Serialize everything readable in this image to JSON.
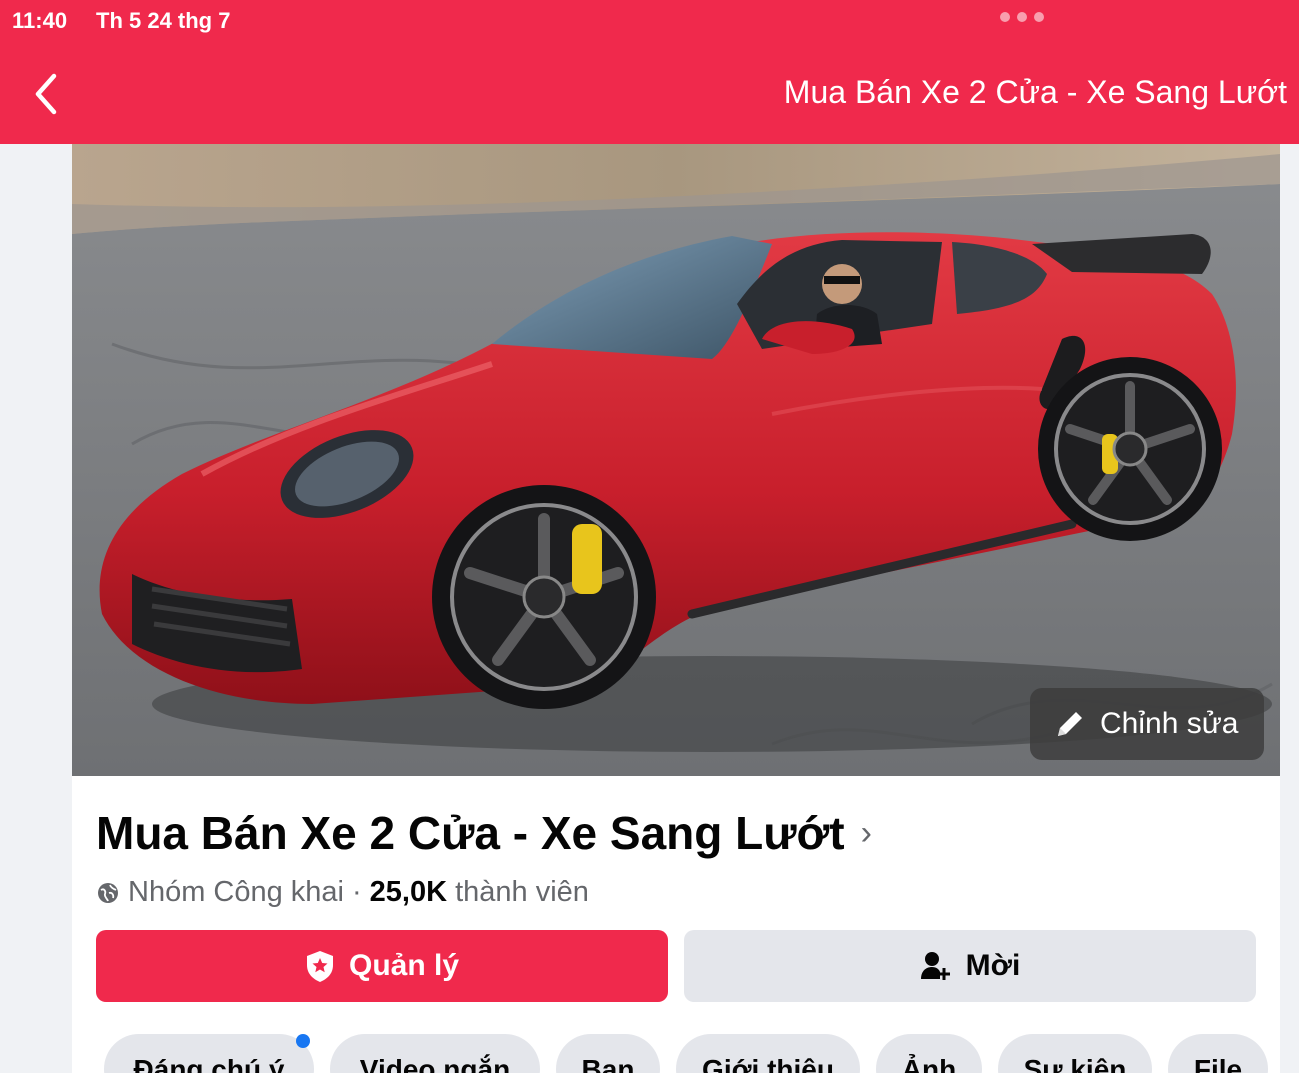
{
  "status_bar": {
    "time": "11:40",
    "date": "Th 5 24 thg 7"
  },
  "nav": {
    "title": "Mua Bán Xe 2 Cửa - Xe Sang Lướt",
    "back_icon": "chevron-left-icon"
  },
  "cover": {
    "edit_label": "Chỉnh sửa",
    "edit_icon": "pencil-icon"
  },
  "group": {
    "name": "Mua Bán Xe 2 Cửa - Xe Sang Lướt",
    "privacy": "Nhóm Công khai",
    "separator": "·",
    "member_count": "25,0K",
    "member_suffix": "thành viên"
  },
  "actions": {
    "manage_label": "Quản lý",
    "invite_label": "Mời"
  },
  "tabs": [
    {
      "label": "Đáng chú ý",
      "has_dot": true
    },
    {
      "label": "Video ngắn"
    },
    {
      "label": "Bạn"
    },
    {
      "label": "Giới thiệu"
    },
    {
      "label": "Ảnh"
    },
    {
      "label": "Sự kiện"
    },
    {
      "label": "File"
    }
  ],
  "colors": {
    "brand": "#f0294c",
    "secondary_button": "#e4e6eb",
    "notification_dot": "#1877f2"
  }
}
